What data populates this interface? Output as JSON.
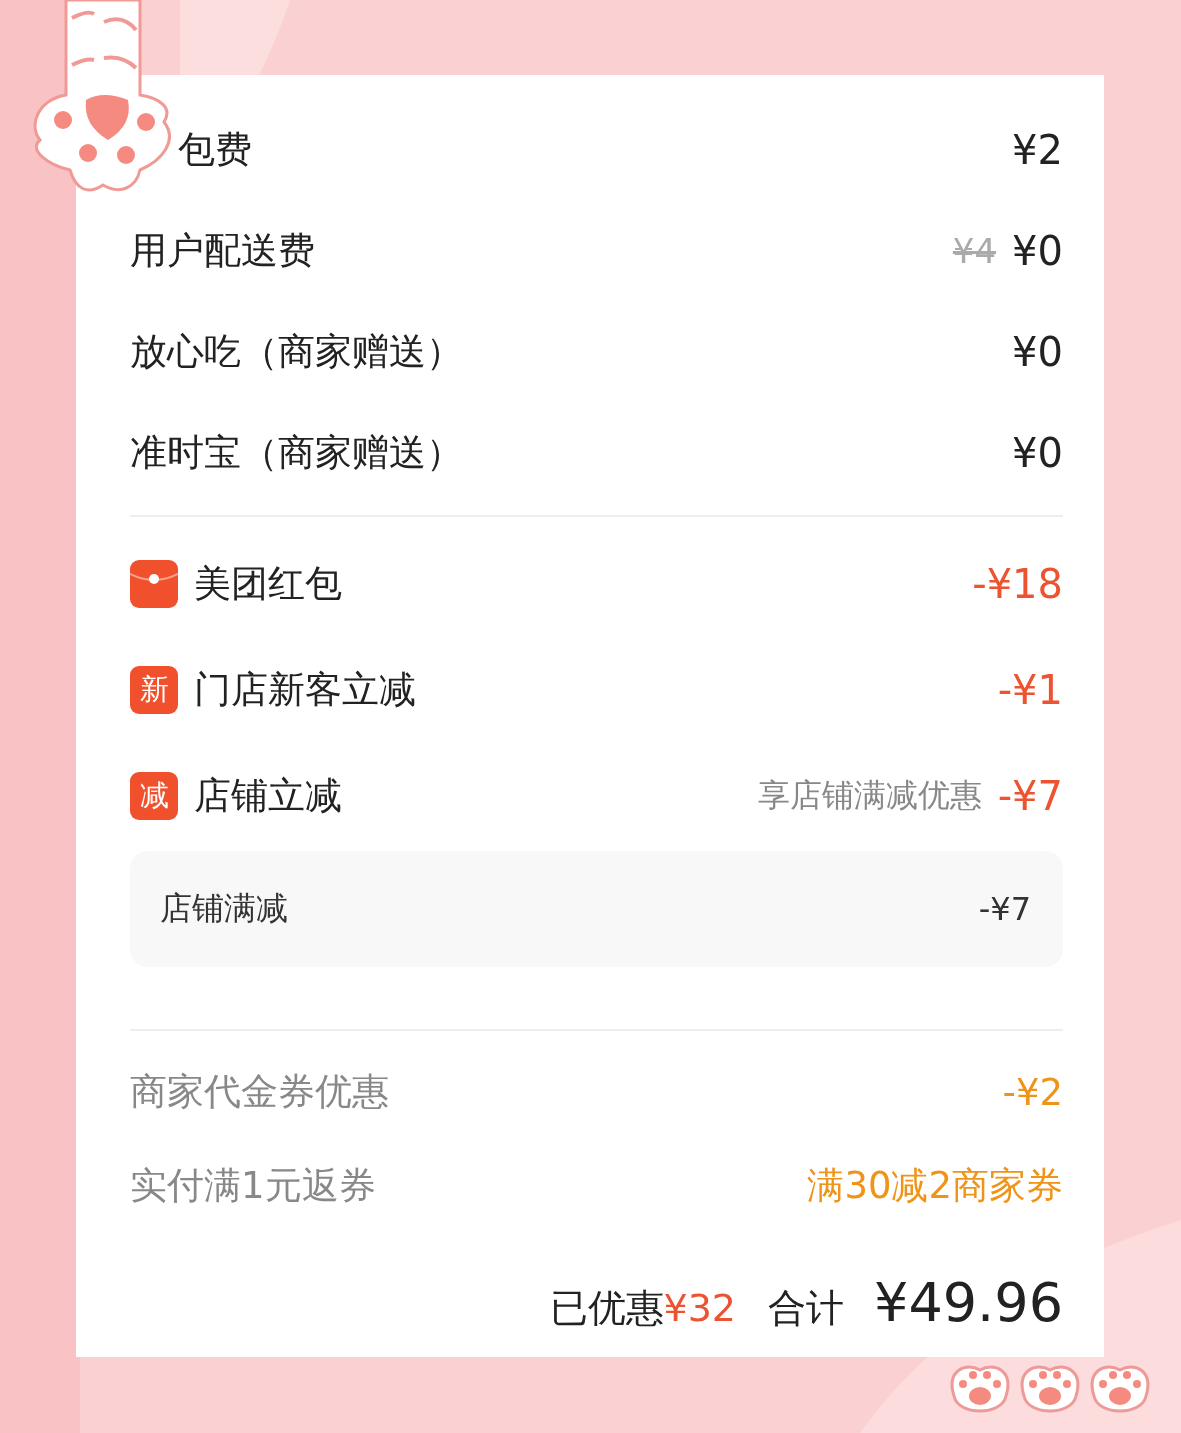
{
  "fees": [
    {
      "label": "包费",
      "amount": "¥2"
    },
    {
      "label": "用户配送费",
      "original": "¥4",
      "amount": "¥0"
    },
    {
      "label": "放心吃（商家赠送）",
      "amount": "¥0"
    },
    {
      "label": "准时宝（商家赠送）",
      "amount": "¥0"
    }
  ],
  "discounts": [
    {
      "kind": "packet",
      "label": "美团红包",
      "amount": "-¥18"
    },
    {
      "kind": "text",
      "badge": "新",
      "label": "门店新客立减",
      "amount": "-¥1"
    },
    {
      "kind": "text",
      "badge": "减",
      "label": "店铺立减",
      "note": "享店铺满减优惠",
      "amount": "-¥7",
      "details": [
        {
          "label": "店铺满减",
          "amount": "-¥7"
        }
      ]
    }
  ],
  "merchant": [
    {
      "label": "商家代金券优惠",
      "value": "-¥2"
    },
    {
      "label": "实付满1元返券",
      "value": "满30减2商家券"
    }
  ],
  "summary": {
    "saved_label": "已优惠",
    "saved": "¥32",
    "total_label": "合计",
    "total": "¥49.96"
  }
}
